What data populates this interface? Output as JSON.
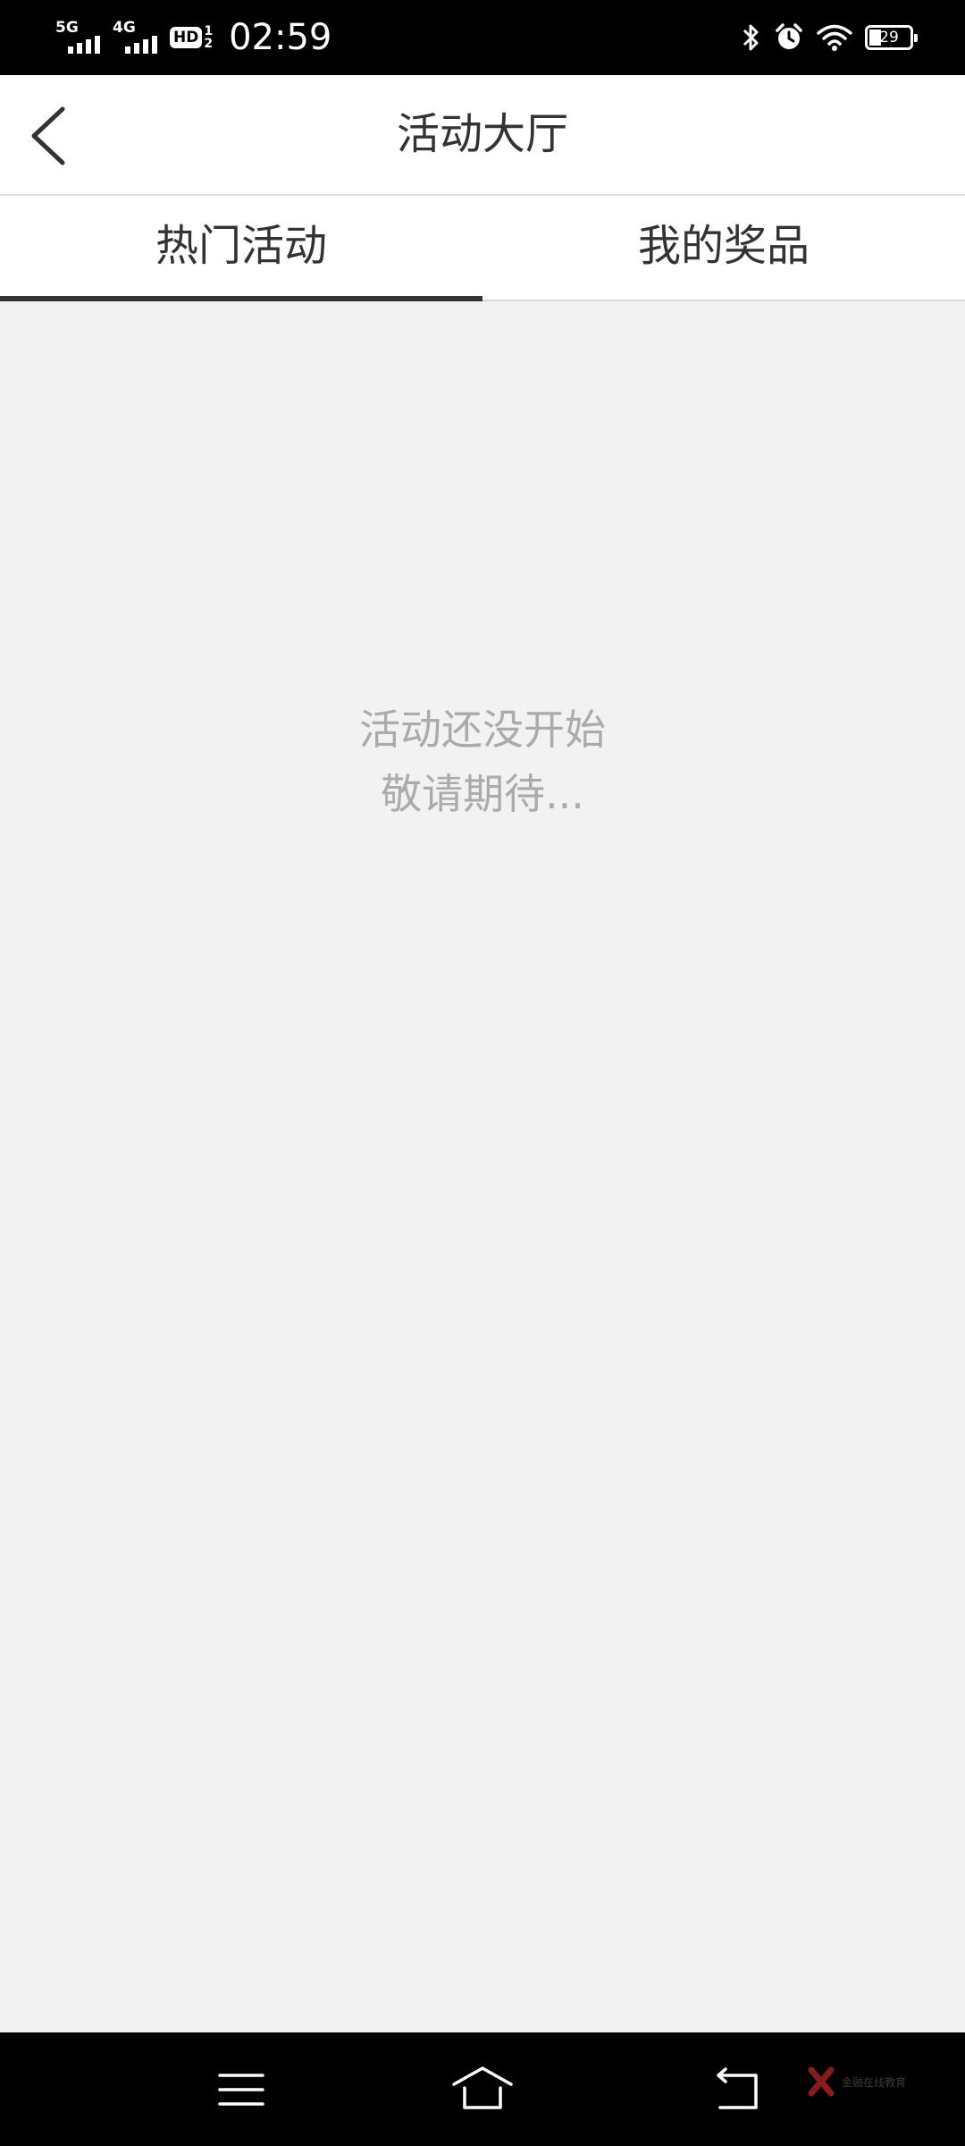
{
  "status_bar": {
    "network_1": "5G",
    "network_2": "4G",
    "hd": "HD",
    "hd_sub_top": "1",
    "hd_sub_bottom": "2",
    "time": "02:59",
    "battery_level": "29",
    "battery_fraction": 0.29
  },
  "header": {
    "title": "活动大厅"
  },
  "tabs": [
    {
      "label": "热门活动",
      "active": true
    },
    {
      "label": "我的奖品",
      "active": false
    }
  ],
  "empty_state": {
    "line1": "活动还没开始",
    "line2": "敬请期待..."
  },
  "nav_bar": {
    "icons": [
      "menu-icon",
      "home-icon",
      "back-icon"
    ]
  },
  "watermark": {
    "text": "金融在线教育"
  },
  "colors": {
    "status_bar_bg": "#000000",
    "page_bg": "#f2f2f2",
    "tab_indicator": "#333333",
    "empty_text": "#ababab",
    "watermark_logo": "#8b1a1a"
  }
}
